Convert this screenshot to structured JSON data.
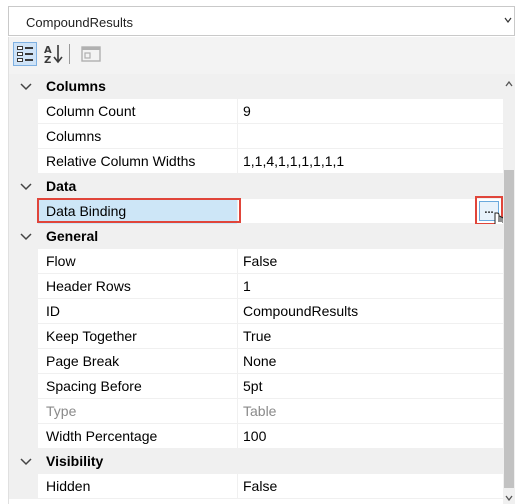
{
  "object_selector": {
    "value": "CompoundResults",
    "icon": "dropdown-arrow"
  },
  "toolbar": {
    "buttons": [
      {
        "name": "categorized",
        "icon": "categorized-icon",
        "active": true
      },
      {
        "name": "alphabetical",
        "icon": "sort-az-icon",
        "active": false
      },
      {
        "name": "property-pages",
        "icon": "property-pages-icon",
        "active": false
      }
    ]
  },
  "grid": {
    "categories": [
      {
        "label": "Columns",
        "properties": [
          {
            "name": "Column Count",
            "value": "9"
          },
          {
            "name": "Columns",
            "value": ""
          },
          {
            "name": "Relative Column Widths",
            "value": "1,1,4,1,1,1,1,1,1"
          }
        ]
      },
      {
        "label": "Data",
        "properties": [
          {
            "name": "Data Binding",
            "value": "",
            "selected": true,
            "ellipsis": "..."
          }
        ]
      },
      {
        "label": "General",
        "properties": [
          {
            "name": "Flow",
            "value": "False"
          },
          {
            "name": "Header Rows",
            "value": "1"
          },
          {
            "name": "ID",
            "value": "CompoundResults"
          },
          {
            "name": "Keep Together",
            "value": "True"
          },
          {
            "name": "Page Break",
            "value": "None"
          },
          {
            "name": "Spacing Before",
            "value": "5pt"
          },
          {
            "name": "Type",
            "value": "Table",
            "disabled": true
          },
          {
            "name": "Width Percentage",
            "value": "100"
          }
        ]
      },
      {
        "label": "Visibility",
        "properties": [
          {
            "name": "Hidden",
            "value": "False"
          }
        ]
      }
    ]
  },
  "colors": {
    "highlight_border": "#e0453a",
    "selection_fill": "#cde6f7",
    "category_bg": "#f0f0f0"
  }
}
